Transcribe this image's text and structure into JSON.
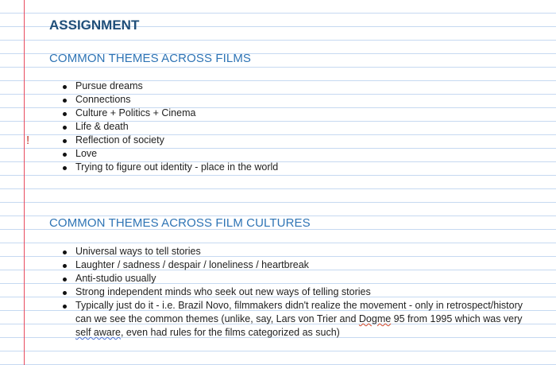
{
  "document": {
    "title": "ASSIGNMENT",
    "sections": [
      {
        "heading": "COMMON THEMES ACROSS FILMS",
        "items": [
          "Pursue dreams",
          "Connections",
          "Culture + Politics + Cinema",
          "Life & death",
          "Reflection of society",
          "Love",
          "Trying to figure out identity - place in the world"
        ],
        "flag_mark": "!"
      },
      {
        "heading": "COMMON THEMES ACROSS FILM CULTURES",
        "items": [
          "Universal ways to tell stories",
          "Laughter / sadness / despair / loneliness / heartbreak",
          "Anti-studio usually",
          "Strong independent minds who seek out new ways of telling stories"
        ],
        "last_item": {
          "part1": "Typically just do it - i.e. Brazil Novo, filmmakers didn't realize the movement - only in retrospect/history can we see the common themes (unlike, say, Lars von Trier and ",
          "dogme": "Dogme",
          "part2": " 95 from 1995 which was very ",
          "self_aware": "self aware",
          "part3": ", even had rules for the films categorized as such)"
        }
      }
    ]
  },
  "colors": {
    "title": "#1f4e79",
    "heading": "#2e74b5",
    "rule_line": "#c6d9f1",
    "margin_line": "#e84a5f",
    "flag": "#c0392b"
  }
}
